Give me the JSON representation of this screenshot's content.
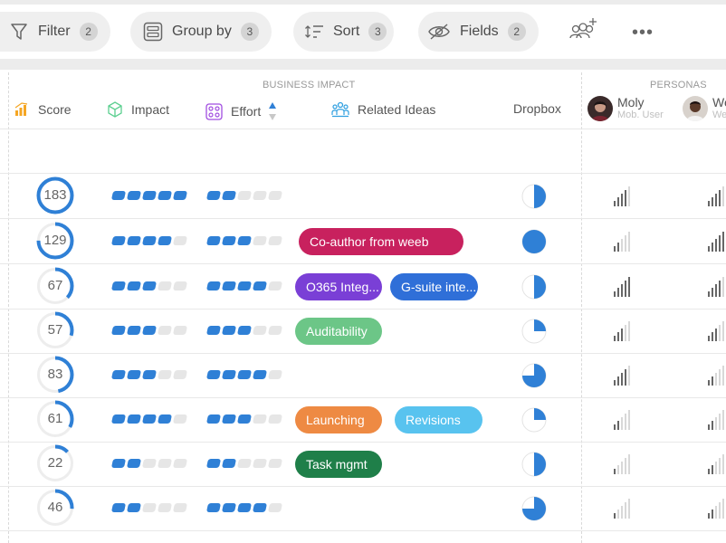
{
  "toolbar": {
    "filter": {
      "label": "Filter",
      "count": "2"
    },
    "group_by": {
      "label": "Group by",
      "count": "3"
    },
    "sort": {
      "label": "Sort",
      "count": "3"
    },
    "fields": {
      "label": "Fields",
      "count": "2"
    },
    "more": "•••"
  },
  "groups": {
    "business_impact": "BUSINESS IMPACT",
    "personas": "PERSONAS"
  },
  "columns": {
    "score": "Score",
    "impact": "Impact",
    "effort": "Effort",
    "related_ideas": "Related Ideas",
    "dropbox": "Dropbox"
  },
  "personas": [
    {
      "name": "Moly",
      "role": "Mob. User"
    },
    {
      "name": "We",
      "role": "We"
    }
  ],
  "colors": {
    "accent": "#2f80d6",
    "chip_magenta": "#c8215e",
    "chip_purple": "#7a3fd6",
    "chip_blue": "#2f6fd8",
    "chip_green": "#6cc687",
    "chip_orange": "#ee8a43",
    "chip_cyan": "#58c3ef",
    "chip_darkgreen": "#1f7f49"
  },
  "rows": [
    {
      "score": "183",
      "score_fill": 1.0,
      "impact": 5,
      "effort": 2,
      "chips": [],
      "dropbox": 0.5,
      "persona_levels": [
        4,
        4
      ]
    },
    {
      "score": "129",
      "score_fill": 0.75,
      "impact": 4,
      "effort": 3,
      "chips": [
        {
          "label": "Co-author from weeb",
          "color": "#c8215e"
        }
      ],
      "dropbox": 1.0,
      "persona_levels": [
        2,
        5
      ]
    },
    {
      "score": "67",
      "score_fill": 0.37,
      "impact": 3,
      "effort": 4,
      "chips": [
        {
          "label": "O365 Integ...",
          "color": "#7a3fd6"
        },
        {
          "label": "G-suite inte...",
          "color": "#2f6fd8"
        }
      ],
      "dropbox": 0.5,
      "persona_levels": [
        5,
        4
      ]
    },
    {
      "score": "57",
      "score_fill": 0.3,
      "impact": 3,
      "effort": 3,
      "chips": [
        {
          "label": "Auditability",
          "color": "#6cc687"
        }
      ],
      "dropbox": 0.25,
      "persona_levels": [
        3,
        3
      ]
    },
    {
      "score": "83",
      "score_fill": 0.47,
      "impact": 3,
      "effort": 4,
      "chips": [],
      "dropbox": 0.75,
      "persona_levels": [
        4,
        2
      ]
    },
    {
      "score": "61",
      "score_fill": 0.33,
      "impact": 4,
      "effort": 3,
      "chips": [
        {
          "label": "Launching",
          "color": "#ee8a43"
        },
        {
          "label": "Revisions",
          "color": "#58c3ef"
        }
      ],
      "dropbox": 0.25,
      "persona_levels": [
        2,
        2
      ]
    },
    {
      "score": "22",
      "score_fill": 0.13,
      "impact": 2,
      "effort": 2,
      "chips": [
        {
          "label": "Task mgmt",
          "color": "#1f7f49"
        }
      ],
      "dropbox": 0.5,
      "persona_levels": [
        1,
        2
      ]
    },
    {
      "score": "46",
      "score_fill": 0.26,
      "impact": 2,
      "effort": 4,
      "chips": [],
      "dropbox": 0.75,
      "persona_levels": [
        1,
        2
      ]
    }
  ]
}
